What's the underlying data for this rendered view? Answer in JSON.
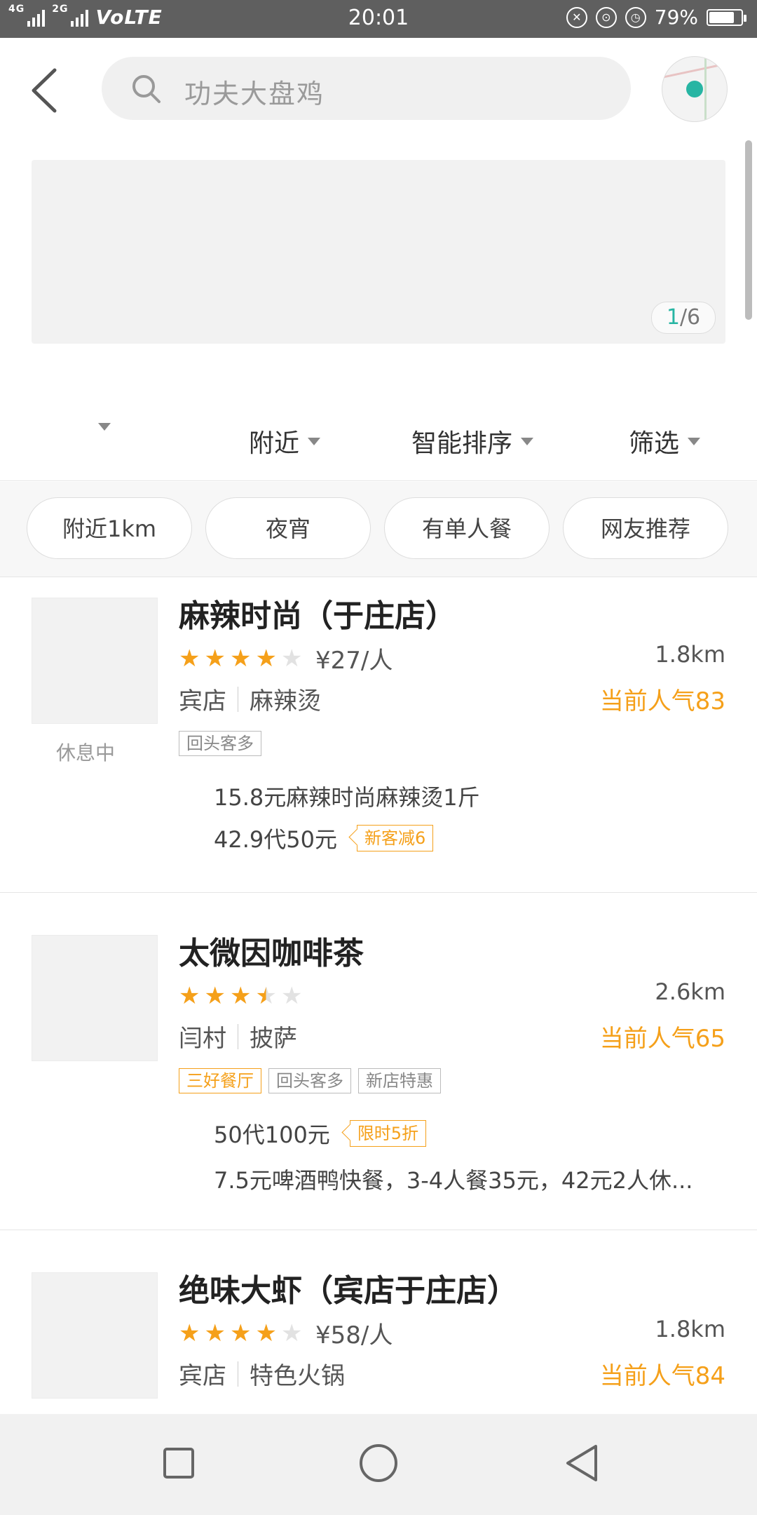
{
  "status_bar": {
    "network_left": "4G",
    "network_right": "2G",
    "volte": "VoLTE",
    "time": "20:01",
    "battery": "79%",
    "battery_level": 0.79
  },
  "search": {
    "placeholder": "功夫大盘鸡"
  },
  "banner": {
    "pager_current": "1",
    "pager_total": "/6"
  },
  "filters": [
    {
      "label": ""
    },
    {
      "label": "附近"
    },
    {
      "label": "智能排序"
    },
    {
      "label": "筛选"
    }
  ],
  "quick_filters": [
    "附近1km",
    "夜宵",
    "有单人餐",
    "网友推荐"
  ],
  "restaurants": [
    {
      "name": "麻辣时尚（于庄店）",
      "rating": 4,
      "price": "¥27/人",
      "distance": "1.8km",
      "area": "宾店",
      "category": "麻辣烫",
      "popularity": "当前人气83",
      "status": "休息中",
      "tags": [
        {
          "text": "回头客多",
          "style": "gray"
        }
      ],
      "deals": [
        {
          "text": "15.8元麻辣时尚麻辣烫1斤",
          "badge": ""
        },
        {
          "text": "42.9代50元",
          "badge": "新客减6"
        }
      ]
    },
    {
      "name": "太微因咖啡茶",
      "rating": 3.5,
      "price": "",
      "distance": "2.6km",
      "area": "闫村",
      "category": "披萨",
      "popularity": "当前人气65",
      "status": "",
      "tags": [
        {
          "text": "三好餐厅",
          "style": "orange"
        },
        {
          "text": "回头客多",
          "style": "gray"
        },
        {
          "text": "新店特惠",
          "style": "gray"
        }
      ],
      "deals": [
        {
          "text": "50代100元",
          "badge": "限时5折"
        },
        {
          "text": "7.5元啤酒鸭快餐，3-4人餐35元，42元2人休...",
          "badge": ""
        }
      ]
    },
    {
      "name": "绝味大虾（宾店于庄店）",
      "rating": 4,
      "price": "¥58/人",
      "distance": "1.8km",
      "area": "宾店",
      "category": "特色火锅",
      "popularity": "当前人气84",
      "status": "",
      "tags": [],
      "deals": []
    }
  ],
  "colors": {
    "accent_orange": "#f5a01a",
    "accent_teal": "#27b5a3",
    "status_bar": "#5f5f5f"
  },
  "icons": {
    "back": "chevron-left-icon",
    "search": "search-icon",
    "map": "map-icon",
    "nav_recent": "square-icon",
    "nav_home": "circle-icon",
    "nav_back": "triangle-back-icon"
  }
}
